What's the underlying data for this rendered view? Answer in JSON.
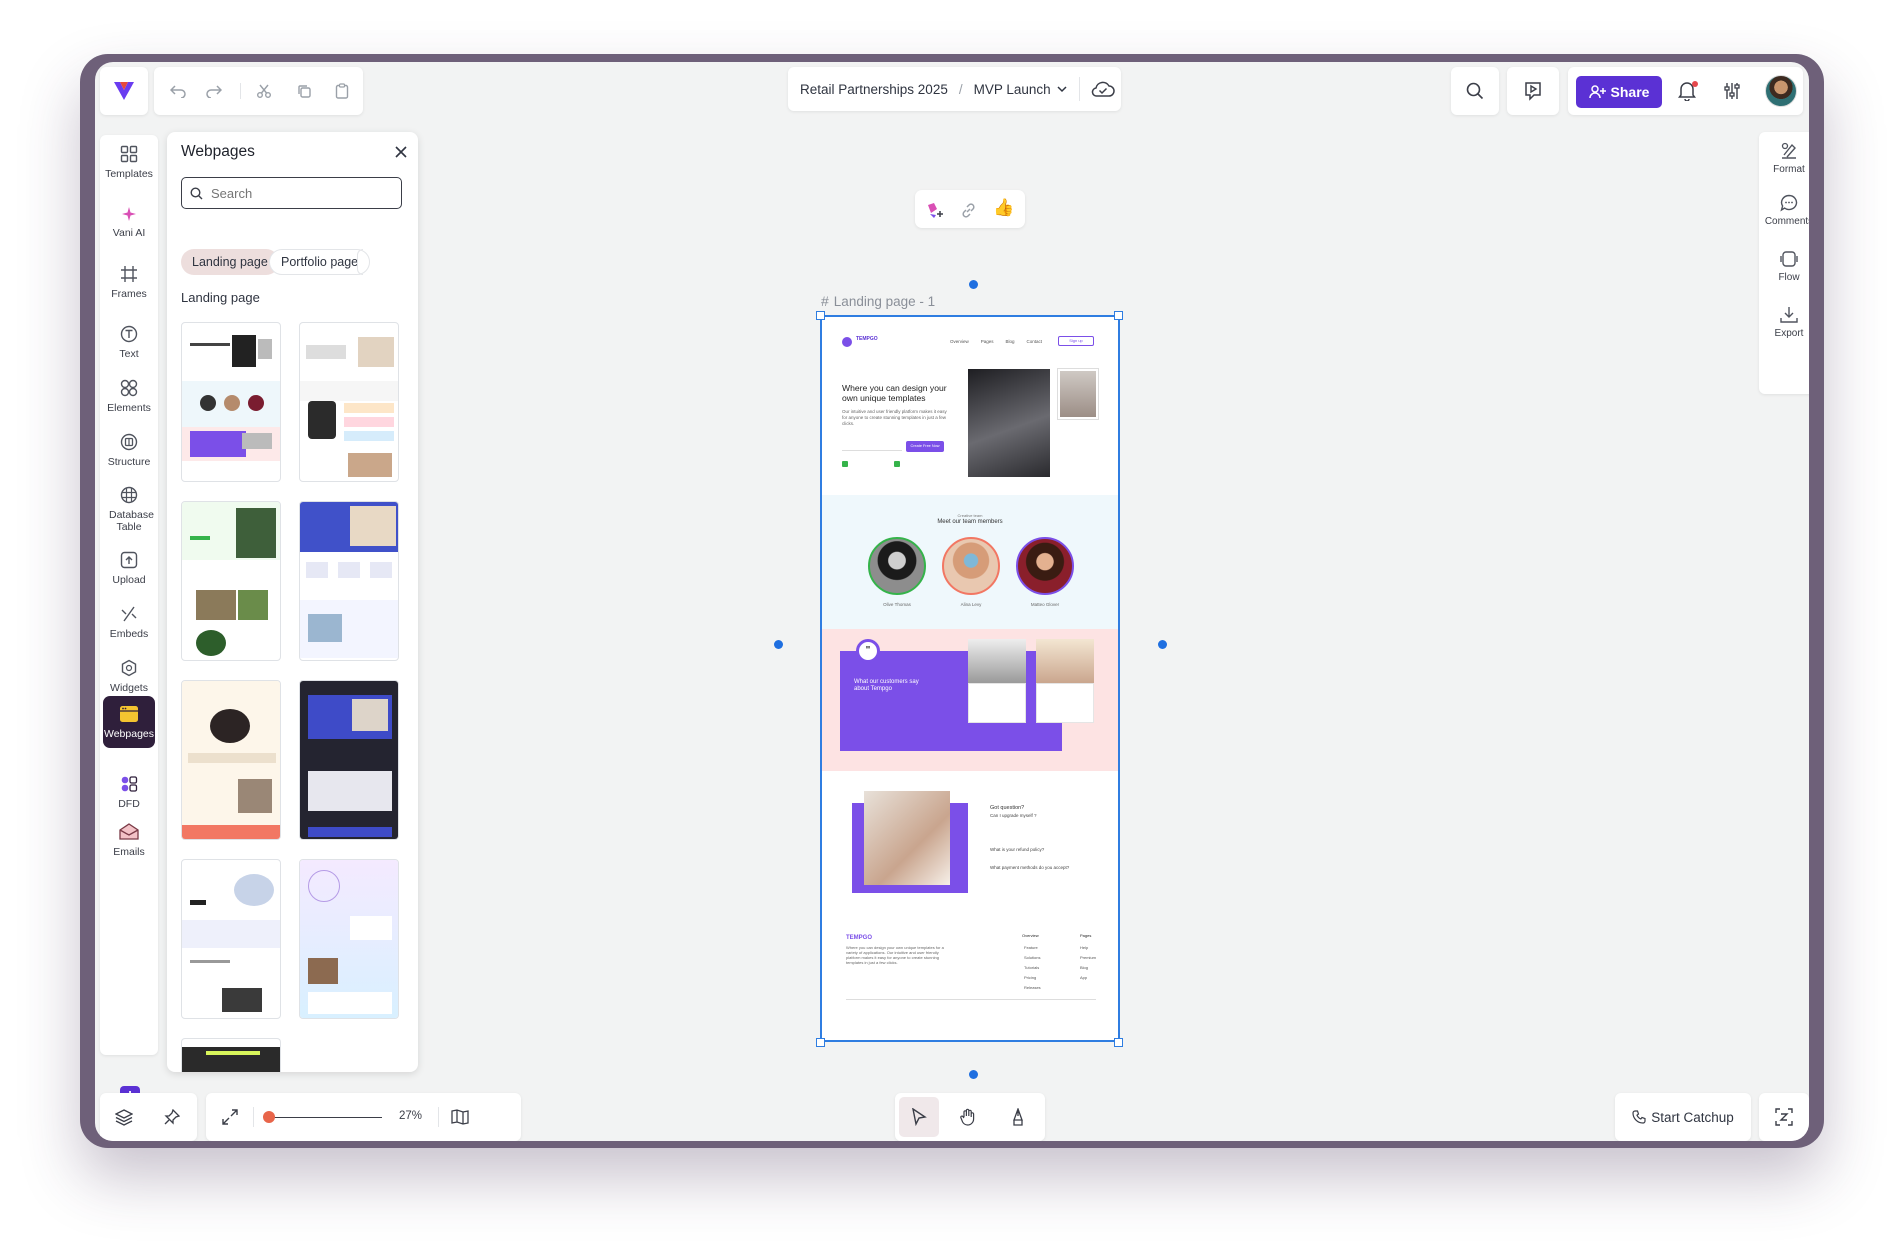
{
  "breadcrumb": {
    "project": "Retail Partnerships 2025",
    "separator": "/",
    "page": "MVP Launch"
  },
  "topbar": {
    "share_label": "Share"
  },
  "colors": {
    "accent": "#5b31d4",
    "frame": "#6e6079",
    "selection": "#2f7de1",
    "active_rail": "#2f1f3b",
    "slider_knob": "#e8654a"
  },
  "rail": {
    "items": [
      {
        "label": "Templates",
        "icon": "grid-icon"
      },
      {
        "label": "Vani AI",
        "icon": "sparkle-icon"
      },
      {
        "label": "Frames",
        "icon": "hash-icon"
      },
      {
        "label": "Text",
        "icon": "text-icon"
      },
      {
        "label": "Elements",
        "icon": "shapes-icon"
      },
      {
        "label": "Structure",
        "icon": "structure-icon"
      },
      {
        "label": "Database Table",
        "icon": "table-icon"
      },
      {
        "label": "Upload",
        "icon": "upload-icon"
      },
      {
        "label": "Embeds",
        "icon": "embed-icon"
      },
      {
        "label": "Widgets",
        "icon": "widget-icon"
      },
      {
        "label": "Webpages",
        "icon": "webpage-icon"
      },
      {
        "label": "DFD",
        "icon": "dfd-icon"
      },
      {
        "label": "Emails",
        "icon": "email-icon"
      }
    ]
  },
  "panel": {
    "title": "Webpages",
    "search_placeholder": "Search",
    "chips": [
      "Landing page",
      "Portfolio page"
    ],
    "section_title": "Landing page"
  },
  "right_tools": [
    {
      "label": "Format",
      "icon": "format-icon"
    },
    {
      "label": "Comments",
      "icon": "comment-icon"
    },
    {
      "label": "Flow",
      "icon": "flow-icon"
    },
    {
      "label": "Export",
      "icon": "download-icon"
    }
  ],
  "canvas": {
    "frame_label": "Landing page - 1",
    "reaction": "👍",
    "page": {
      "brand": "TEMPGO",
      "nav": [
        "Overview",
        "Pages",
        "Blog",
        "Contact"
      ],
      "nav_button": "Sign up",
      "hero_title": "Where you can design your own unique templates",
      "hero_body": "Our intuitive and user friendly platform makes it easy for anyone to create stunning templates in just a few clicks.",
      "hero_cta": "Create Free Now",
      "team_kicker": "Creative team",
      "team_title": "Meet our team members",
      "team": [
        "Olive Thomas",
        "Alina Levy",
        "Matteo Glover"
      ],
      "testimonial_title": "What our customers say about Tempgo",
      "faq_title": "Got question?",
      "faq": [
        "Can I upgrade myself ?",
        "What is your refund policy?",
        "What payment methods do you accept?"
      ],
      "footer_brand": "TEMPGO",
      "footer_body": "Where you can design your own unique templates for a variety of applications. Our intuitive and user friendly platform makes it easy for anyone to create stunning templates in just a few clicks.",
      "footer_col1_title": "Overview",
      "footer_col1": [
        "Feature",
        "Solutions",
        "Tutorials",
        "Pricing",
        "Releases"
      ],
      "footer_col2_title": "Pages",
      "footer_col2": [
        "Help",
        "Premium",
        "Blog",
        "App"
      ]
    }
  },
  "bottombar": {
    "zoom": "27%",
    "catchup_label": "Start Catchup"
  }
}
